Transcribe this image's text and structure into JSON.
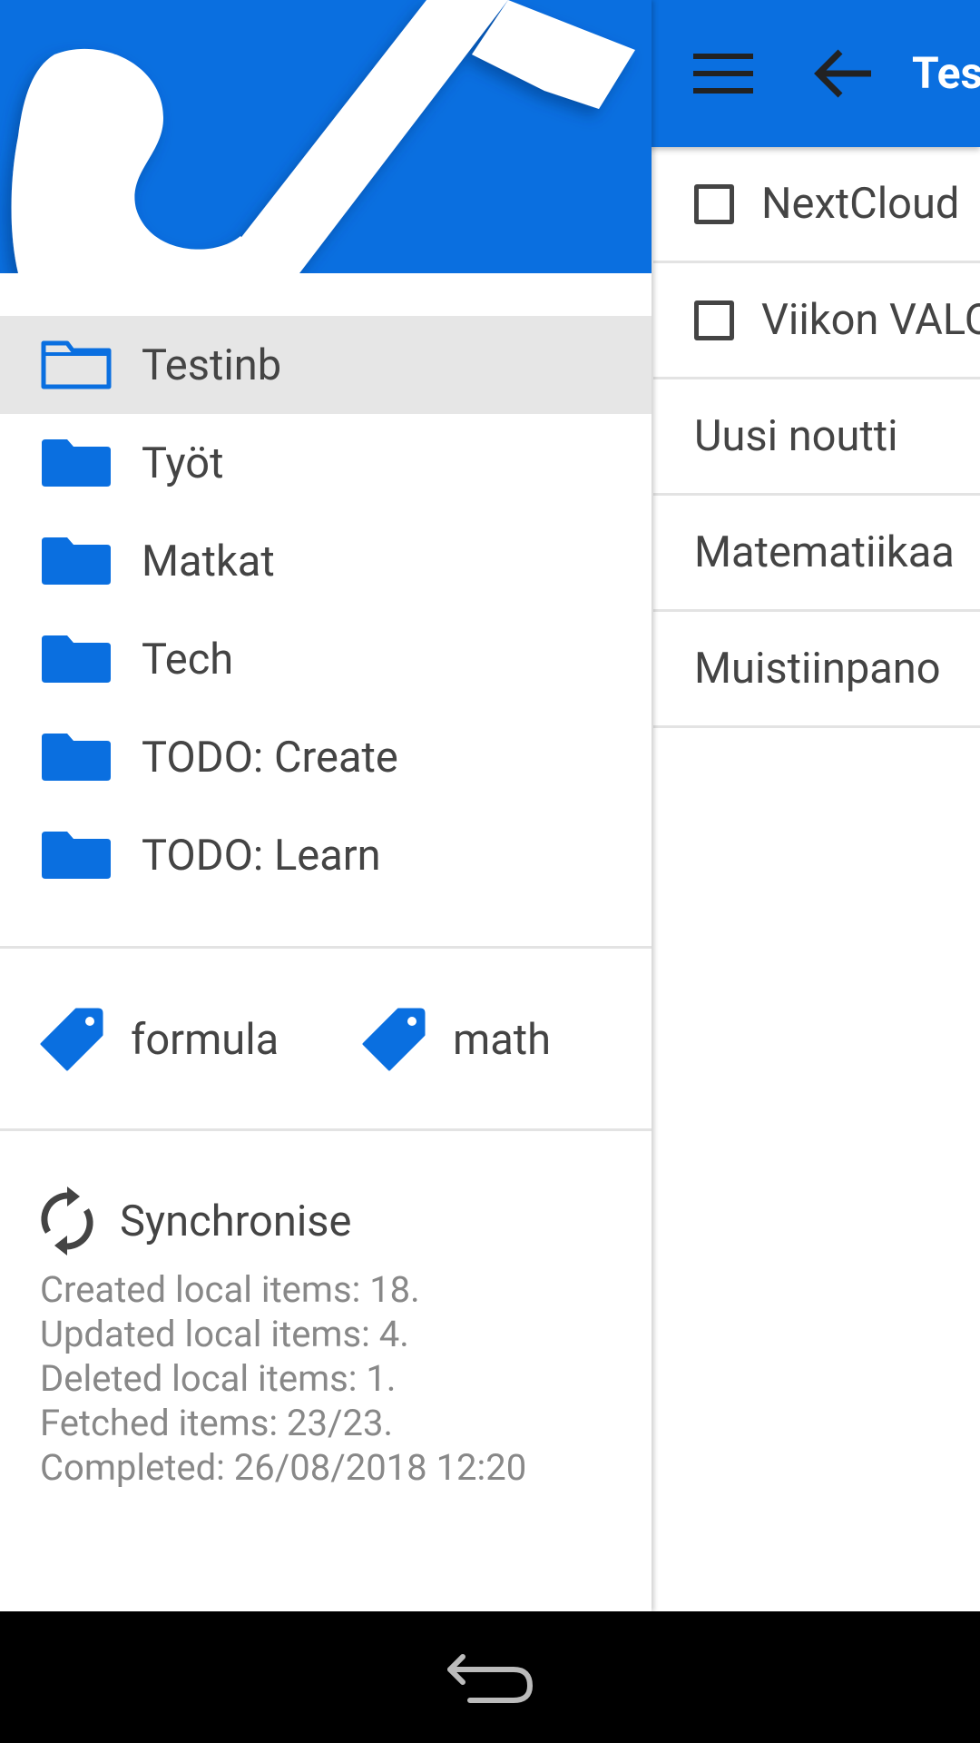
{
  "appbar": {
    "title": "Tes",
    "menu_icon": "menu-icon",
    "back_icon": "arrow-back-icon",
    "color": "#0a6fe0"
  },
  "notes": [
    {
      "title": "NextCloud",
      "checkbox": true
    },
    {
      "title": "Viikon VALO",
      "checkbox": true
    },
    {
      "title": "Uusi noutti",
      "checkbox": false
    },
    {
      "title": "Matematiikaa",
      "checkbox": false
    },
    {
      "title": "Muistiinpano",
      "checkbox": false
    }
  ],
  "drawer": {
    "folders": [
      {
        "label": "Testinb",
        "selected": true,
        "icon": "folder-outline-icon"
      },
      {
        "label": "Työt",
        "selected": false,
        "icon": "folder-icon"
      },
      {
        "label": "Matkat",
        "selected": false,
        "icon": "folder-icon"
      },
      {
        "label": "Tech",
        "selected": false,
        "icon": "folder-icon"
      },
      {
        "label": "TODO: Create",
        "selected": false,
        "icon": "folder-icon"
      },
      {
        "label": "TODO: Learn",
        "selected": false,
        "icon": "folder-icon"
      }
    ],
    "tags": [
      {
        "label": "formula",
        "icon": "tag-icon"
      },
      {
        "label": "math",
        "icon": "tag-icon"
      }
    ],
    "sync": {
      "label": "Synchronise",
      "icon": "sync-icon",
      "lines": [
        "Created local items: 18.",
        "Updated local items: 4.",
        "Deleted local items: 1.",
        "Fetched items: 23/23.",
        "Completed: 26/08/2018 12:20"
      ]
    }
  },
  "navbar": {
    "back_icon": "nav-back-icon"
  }
}
